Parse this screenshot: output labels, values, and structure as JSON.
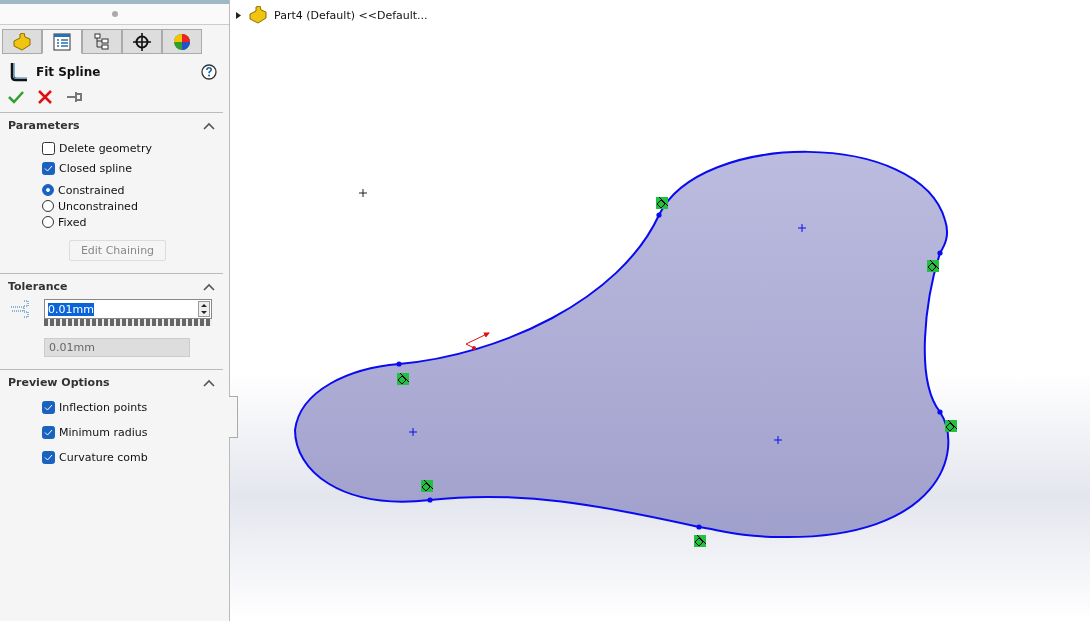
{
  "tabs": [
    {
      "kind": "part",
      "selected": false
    },
    {
      "kind": "property",
      "selected": true
    },
    {
      "kind": "config",
      "selected": false
    },
    {
      "kind": "target",
      "selected": false
    },
    {
      "kind": "appearance",
      "selected": false
    }
  ],
  "feature": {
    "title": "Fit Spline"
  },
  "parameters": {
    "title": "Parameters",
    "expanded": true,
    "checkboxes": [
      {
        "label": "Delete geometry",
        "checked": false
      },
      {
        "label": "Closed spline",
        "checked": true
      }
    ],
    "radios": [
      {
        "label": "Constrained",
        "selected": true
      },
      {
        "label": "Unconstrained",
        "selected": false
      },
      {
        "label": "Fixed",
        "selected": false
      }
    ],
    "button": {
      "label": "Edit Chaining",
      "disabled": true
    }
  },
  "tolerance": {
    "title": "Tolerance",
    "expanded": true,
    "value": "0.01mm",
    "readout": "0.01mm"
  },
  "preview": {
    "title": "Preview Options",
    "expanded": true,
    "checkboxes": [
      {
        "label": "Inflection points",
        "checked": true
      },
      {
        "label": "Minimum radius",
        "checked": true
      },
      {
        "label": "Curvature comb",
        "checked": true
      }
    ]
  },
  "tree": {
    "label": "Part4 (Default) <<Default...",
    "expanded": false
  }
}
